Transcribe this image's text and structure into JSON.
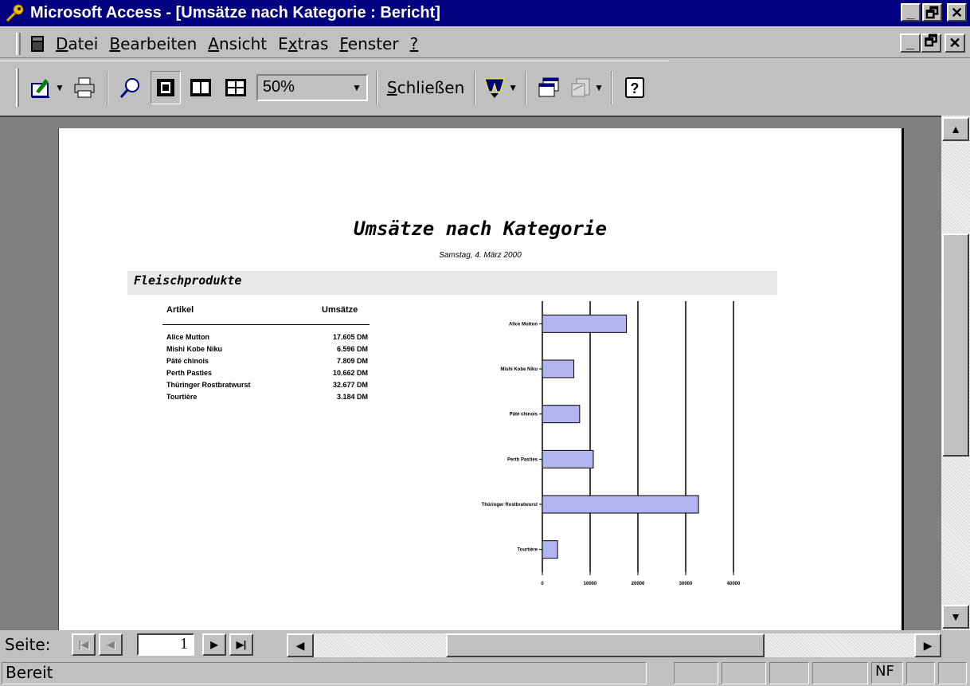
{
  "window": {
    "title": "Microsoft Access - [Umsätze nach Kategorie : Bericht]"
  },
  "menu": {
    "items": [
      {
        "label": "Datei",
        "underline": "D",
        "rest": "atei"
      },
      {
        "label": "Bearbeiten",
        "underline": "B",
        "rest": "earbeiten"
      },
      {
        "label": "Ansicht",
        "underline": "A",
        "rest": "nsicht"
      },
      {
        "label": "Extras",
        "pre": "E",
        "underline": "x",
        "rest": "tras"
      },
      {
        "label": "Fenster",
        "underline": "F",
        "rest": "enster"
      },
      {
        "label": "?",
        "underline": "?",
        "rest": ""
      }
    ]
  },
  "toolbar": {
    "zoom_value": "50%",
    "close_label_u": "S",
    "close_label_rest": "chließen"
  },
  "report": {
    "title": "Umsätze nach Kategorie",
    "date": "Samstag, 4. März 2000",
    "category": "Fleischprodukte",
    "col_article": "Artikel",
    "col_sales": "Umsätze",
    "rows": [
      {
        "name": "Alice Mutton",
        "value": "17.605 DM"
      },
      {
        "name": "Mishi Kobe Niku",
        "value": "6.596 DM"
      },
      {
        "name": "Pâté chinois",
        "value": "7.809 DM"
      },
      {
        "name": "Perth Pasties",
        "value": "10.662 DM"
      },
      {
        "name": "Thüringer Rostbratwurst",
        "value": "32.677 DM"
      },
      {
        "name": "Tourtière",
        "value": "3.184 DM"
      }
    ]
  },
  "chart_data": {
    "type": "bar",
    "orientation": "horizontal",
    "categories": [
      "Alice Mutton",
      "Mishi Kobe Niku",
      "Pâté chinois",
      "Perth Pasties",
      "Thüringer Rostbratwurst",
      "Tourtière"
    ],
    "values": [
      17605,
      6596,
      7809,
      10662,
      32677,
      3184
    ],
    "xlim": [
      0,
      50000
    ],
    "ticks": [
      "0",
      "10000",
      "20000",
      "30000",
      "40000",
      "50000"
    ],
    "grid": true,
    "bar_color": "#b4b4f0"
  },
  "navigation": {
    "page_label": "Seite:",
    "page_value": "1"
  },
  "status": {
    "text": "Bereit",
    "nf": "NF"
  }
}
